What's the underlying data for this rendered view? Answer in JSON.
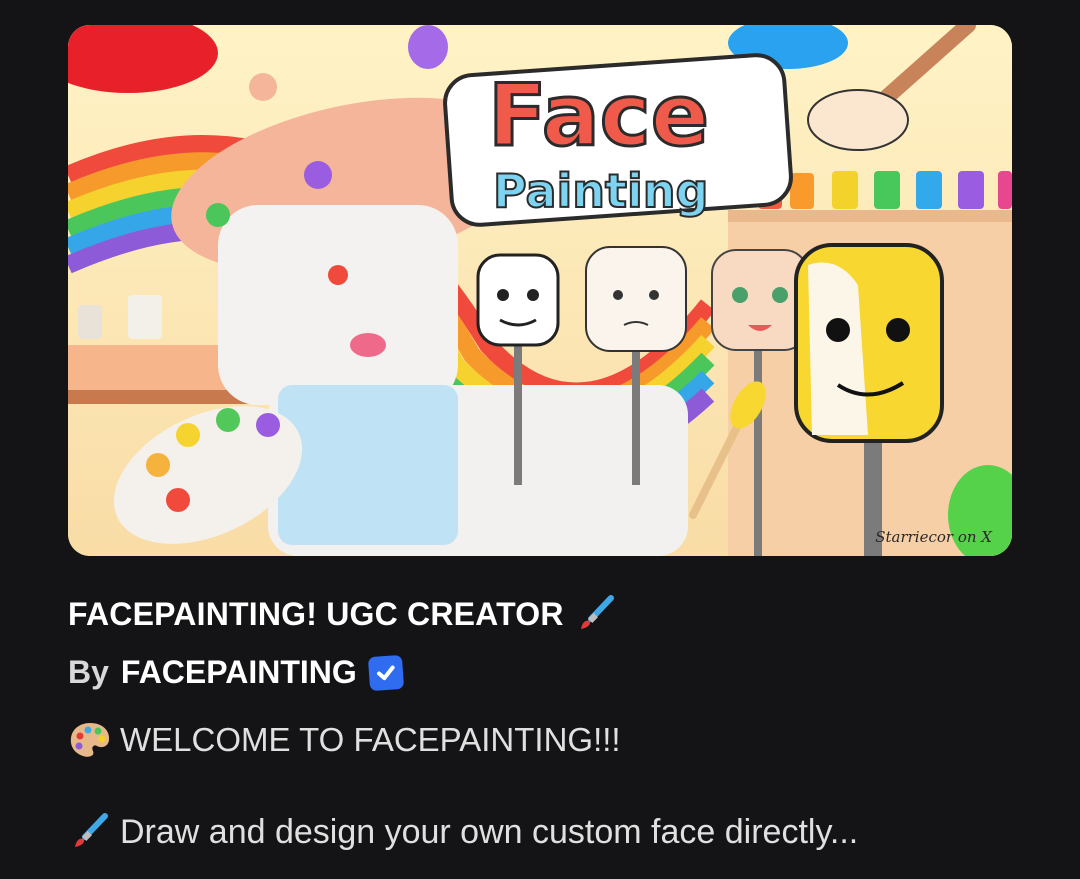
{
  "game": {
    "title": "FACEPAINTING! UGC CREATOR",
    "title_icon": "paintbrush-icon",
    "by_label": "By",
    "creator": "FACEPAINTING",
    "creator_badge": "verified-badge-icon",
    "thumbnail_logo_word_1": "Face",
    "thumbnail_logo_word_2": "Painting",
    "thumbnail_credit": "Starriecor on X"
  },
  "description": {
    "line1_icon": "artist-palette-icon",
    "line1": "WELCOME TO FACEPAINTING!!!",
    "line2_icon": "paintbrush-icon",
    "line2": "Draw and design your own custom face directly..."
  },
  "colors": {
    "background": "#141416",
    "text": "#ffffff",
    "verified": "#2f6cf0",
    "thumbnail_bg": "#fbe7b4"
  }
}
